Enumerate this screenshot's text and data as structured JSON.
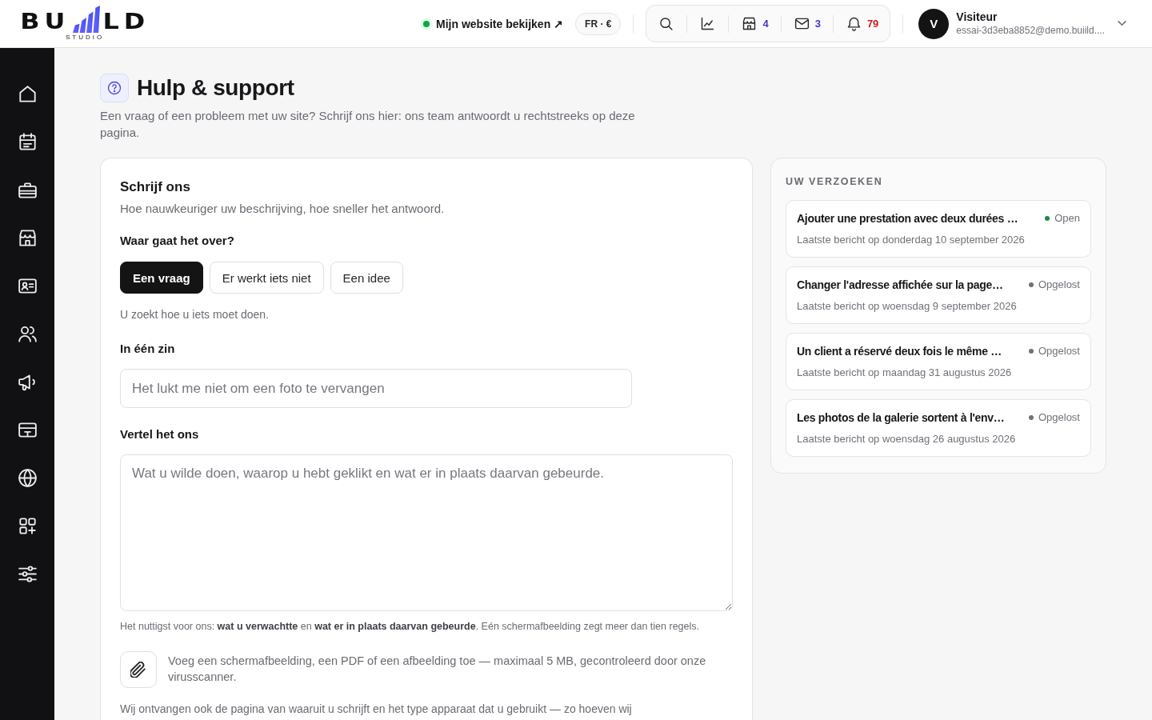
{
  "header": {
    "logo": {
      "left": "BU",
      "right": "LD",
      "tagline": "STUDIO"
    },
    "site_link": {
      "label": "Mijn website bekijken ↗",
      "online": true
    },
    "locale": "FR · €",
    "counters": [
      {
        "count": "4",
        "color": "#4338ca"
      },
      {
        "count": "3",
        "color": "#4338ca"
      },
      {
        "count": "79",
        "color": "#c81e1e"
      }
    ],
    "user": {
      "initial": "V",
      "name": "Visiteur",
      "email": "essai-3d3eba8852@demo.buiild...."
    }
  },
  "page": {
    "title": "Hulp & support",
    "subtitle": "Een vraag of een probleem met uw site? Schrijf ons hier: ons team antwoordt u rechtstreeks op deze pagina."
  },
  "form": {
    "title": "Schrijf ons",
    "subtitle": "Hoe nauwkeuriger uw beschrijving, hoe sneller het antwoord.",
    "topic_label": "Waar gaat het over?",
    "topics": [
      {
        "label": "Een vraag",
        "selected": true
      },
      {
        "label": "Er werkt iets niet",
        "selected": false
      },
      {
        "label": "Een idee",
        "selected": false
      }
    ],
    "topic_hint": "U zoekt hoe u iets moet doen.",
    "summary": {
      "label": "In één zin",
      "placeholder": "Het lukt me niet om een foto te vervangen"
    },
    "details": {
      "label": "Vertel het ons",
      "placeholder": "Wat u wilde doen, waarop u hebt geklikt en wat er in plaats daarvan gebeurde.",
      "hint": "Het nuttigst voor ons: **wat u verwachtte** en **wat er in plaats daarvan gebeurde**. Eén schermafbeelding zegt meer dan tien regels."
    },
    "attachment": "Voeg een schermafbeelding, een PDF of een afbeelding toe — maximaal 5 MB, gecontroleerd door onze virusscanner.",
    "footnote": "Wij ontvangen ook de pagina van waaruit u schrijft en het type apparaat dat u gebruikt — zo hoeven wij"
  },
  "requests": {
    "title": "UW VERZOEKEN",
    "items": [
      {
        "title": "Ajouter une prestation avec deux durées …",
        "status": "Open",
        "color": "#178a45",
        "date": "Laatste bericht op donderdag 10 september 2026"
      },
      {
        "title": "Changer l'adresse affichée sur la page…",
        "status": "Opgelost",
        "color": "#71717a",
        "date": "Laatste bericht op woensdag 9 september 2026"
      },
      {
        "title": "Un client a réservé deux fois le même …",
        "status": "Opgelost",
        "color": "#71717a",
        "date": "Laatste bericht op maandag 31 augustus 2026"
      },
      {
        "title": "Les photos de la galerie sortent à l'env…",
        "status": "Opgelost",
        "color": "#71717a",
        "date": "Laatste bericht op woensdag 26 augustus 2026"
      }
    ]
  }
}
